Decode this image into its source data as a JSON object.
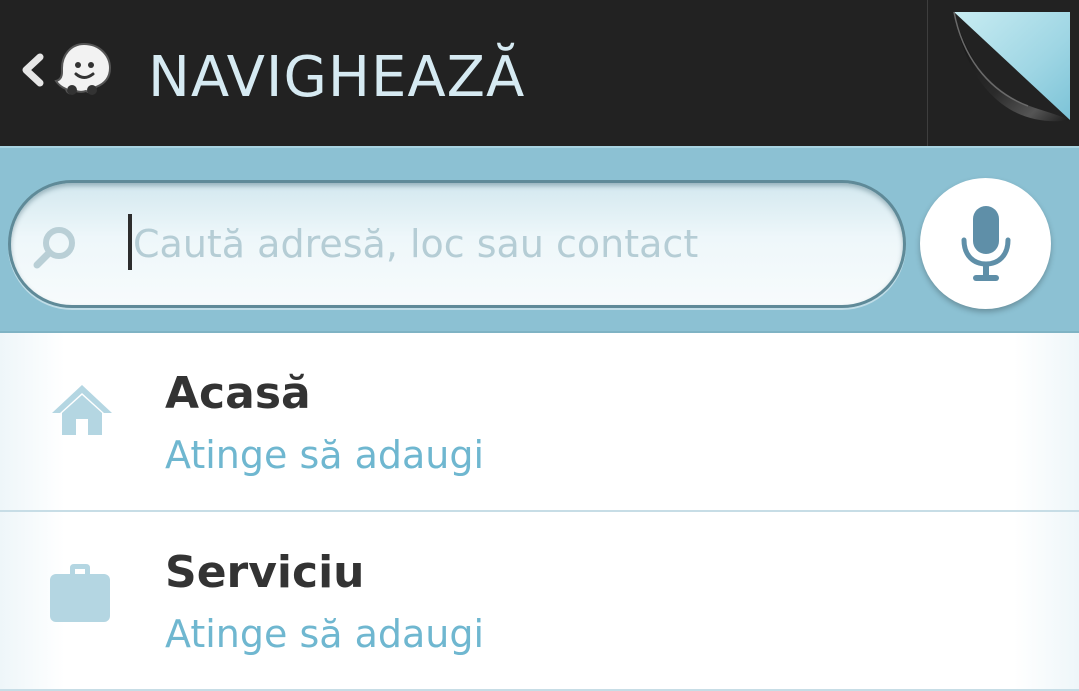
{
  "header": {
    "title": "NAVIGHEAZĂ",
    "back_icon": "chevron-left-icon",
    "logo_icon": "waze-logo-icon",
    "page_curl_icon": "page-curl-icon"
  },
  "search": {
    "placeholder": "Caută adresă, loc sau contact",
    "search_icon": "search-icon",
    "voice_icon": "microphone-icon"
  },
  "favorites": [
    {
      "title": "Acasă",
      "subtitle": "Atinge să adaugi",
      "icon": "home-icon"
    },
    {
      "title": "Serviciu",
      "subtitle": "Atinge să adaugi",
      "icon": "briefcase-icon"
    }
  ],
  "colors": {
    "header_bg": "#222222",
    "title_text": "#d6eaf2",
    "search_area_bg": "#8cc1d3",
    "accent": "#6fb7d0",
    "mic_icon": "#5f8fa8",
    "list_icon": "#b4d6e2"
  }
}
